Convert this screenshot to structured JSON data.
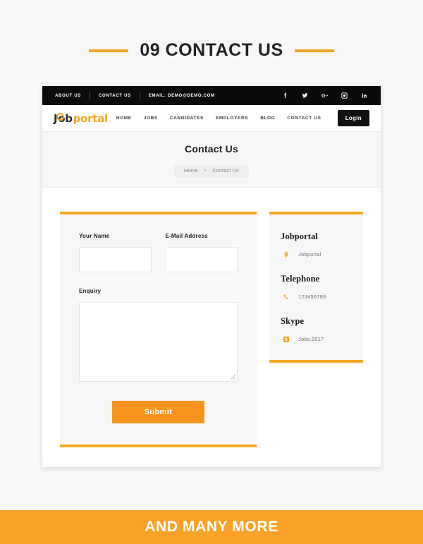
{
  "section": {
    "number_title": "09 CONTACT US"
  },
  "site": {
    "topbar": {
      "links": [
        "ABOUT US",
        "CONTACT US",
        "EMAIL: DEMO@DEMO.COM"
      ],
      "social": [
        "facebook-icon",
        "twitter-icon",
        "google-plus-icon",
        "instagram-icon",
        "linkedin-icon"
      ]
    },
    "logo": {
      "part_j": "J",
      "part_ob": "ob",
      "part_portal": "portal",
      "full": "Jobportal"
    },
    "nav": {
      "items": [
        "HOME",
        "JOBS",
        "CANDIDATES",
        "EMPLOYERS",
        "BLOG",
        "CONTACT US"
      ],
      "login_label": "Login"
    },
    "banner": {
      "title": "Contact Us",
      "breadcrumb_home": "Home",
      "breadcrumb_separator": ">",
      "breadcrumb_current": "Contact Us"
    },
    "form": {
      "name_label": "Your Name",
      "name_value": "",
      "name_placeholder": "",
      "email_label": "E-Mail Address",
      "email_value": "",
      "email_placeholder": "",
      "enquiry_label": "Enquiry",
      "enquiry_value": "",
      "enquiry_placeholder": "",
      "submit_label": "Submit"
    },
    "info": {
      "blocks": [
        {
          "title": "Jobportal",
          "icon": "map-pin-icon",
          "value": "Jobportal"
        },
        {
          "title": "Telephone",
          "icon": "phone-icon",
          "value": "123456789"
        },
        {
          "title": "Skype",
          "icon": "skype-icon",
          "value": "Jobs.2017"
        }
      ]
    }
  },
  "bottom_banner": {
    "text": "AND MANY MORE"
  },
  "colors": {
    "accent_orange": "#f5a623",
    "banner_orange": "#f9a227",
    "submit_orange": "#f7941d",
    "topbar_black": "#0b0b0b",
    "page_bg": "#f7f7f7"
  }
}
